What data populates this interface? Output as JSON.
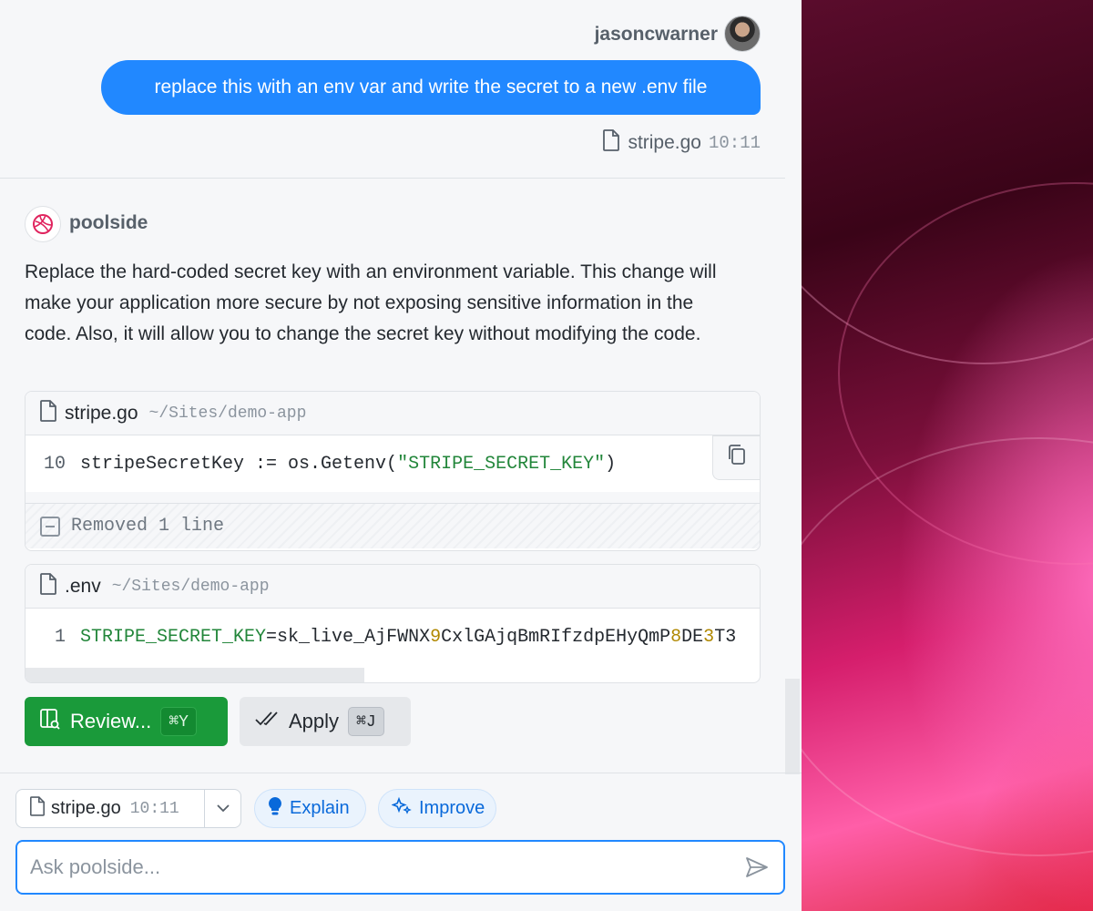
{
  "user": {
    "name": "jasoncwarner",
    "message": "replace this with an env var and write the secret to a new .env file",
    "context_file": "stripe.go",
    "context_time": "10:11"
  },
  "assistant": {
    "name": "poolside",
    "response": "Replace the hard-coded secret key with an environment variable. This change will make your application more secure by not exposing sensitive information in the code. Also, it will allow you to change the secret key without modifying the code."
  },
  "code_blocks": [
    {
      "filename": "stripe.go",
      "path": "~/Sites/demo-app",
      "line_number": "10",
      "code_prefix": "stripeSecretKey := os.Getenv(",
      "code_string": "\"STRIPE_SECRET_KEY\"",
      "code_suffix": ")",
      "removed_label": "Removed 1 line"
    },
    {
      "filename": ".env",
      "path": "~/Sites/demo-app",
      "line_number": "1",
      "env_key": "STRIPE_SECRET_KEY",
      "env_value_parts": [
        "=sk_live_AjFWNX",
        "9",
        "CxlGAjqBmRIfzdpEHyQmP",
        "8",
        "DE",
        "3",
        "T3"
      ]
    }
  ],
  "actions": {
    "review_label": "Review...",
    "review_shortcut": "⌘Y",
    "apply_label": "Apply",
    "apply_shortcut": "⌘J"
  },
  "composer": {
    "context_file": "stripe.go",
    "context_time": "10:11",
    "explain_label": "Explain",
    "improve_label": "Improve",
    "placeholder": "Ask poolside..."
  },
  "colors": {
    "accent": "#2188ff",
    "review_green": "#1a9a3a",
    "string_green": "#22863a",
    "number_gold": "#b08800"
  },
  "icons": [
    "file-icon",
    "copy-icon",
    "minus-box-icon",
    "review-panel-icon",
    "double-check-icon",
    "chevron-down-icon",
    "lightbulb-icon",
    "sparkles-icon",
    "send-icon",
    "poolside-logo-icon"
  ]
}
